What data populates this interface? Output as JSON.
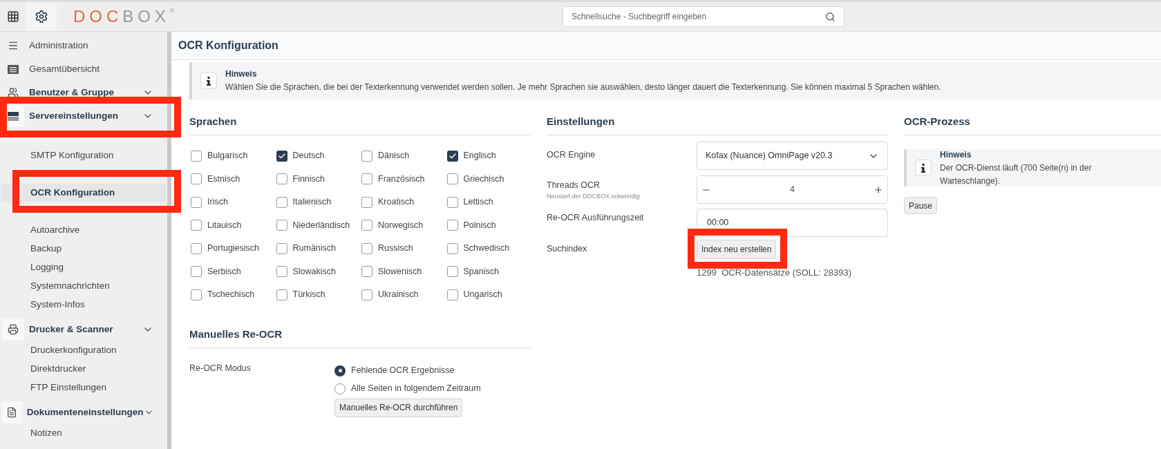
{
  "topbar": {
    "logo_primary": "DOC",
    "logo_secondary": "BOX",
    "logo_mark": "®",
    "search": {
      "placeholder": "Schnellsuche - Suchbegriff eingeben"
    }
  },
  "sidebar": {
    "items": [
      {
        "kind": "link",
        "label": "Administration"
      },
      {
        "kind": "link",
        "label": "Gesamtübersicht"
      },
      {
        "kind": "group",
        "label": "Benutzer & Gruppe"
      },
      {
        "kind": "group",
        "label": "Servereinstellungen"
      },
      {
        "kind": "hidden"
      },
      {
        "kind": "sub",
        "label": "SMTP Konfiguration",
        "selected": false
      },
      {
        "kind": "hidden"
      },
      {
        "kind": "sub",
        "label": "OCR Konfiguration",
        "selected": true
      },
      {
        "kind": "hidden"
      },
      {
        "kind": "sub",
        "label": "Autoarchive",
        "selected": false
      },
      {
        "kind": "sub",
        "label": "Backup",
        "selected": false
      },
      {
        "kind": "sub",
        "label": "Logging",
        "selected": false
      },
      {
        "kind": "sub",
        "label": "Systemnachrichten",
        "selected": false
      },
      {
        "kind": "sub",
        "label": "System-Infos",
        "selected": false
      },
      {
        "kind": "group",
        "label": "Drucker & Scanner"
      },
      {
        "kind": "sub",
        "label": "Druckerkonfiguration",
        "selected": false
      },
      {
        "kind": "sub",
        "label": "Direktdrucker",
        "selected": false
      },
      {
        "kind": "sub",
        "label": "FTP Einstellungen",
        "selected": false
      },
      {
        "kind": "group",
        "label": "Dokumenteneinstellungen"
      },
      {
        "kind": "sub",
        "label": "Notizen",
        "selected": false
      }
    ]
  },
  "page_title": "OCR Konfiguration",
  "notice": {
    "title": "Hinweis",
    "text": "Wählen Sie die Sprachen, die bei der Texterkennung verwendet werden sollen. Je mehr Sprachen sie auswählen, desto länger dauert die Texterkennung. Sie können maximal 5 Sprachen wählen."
  },
  "languages": {
    "heading": "Sprachen",
    "items": [
      {
        "label": "Bulgarisch",
        "checked": false
      },
      {
        "label": "Deutsch",
        "checked": true
      },
      {
        "label": "Dänisch",
        "checked": false
      },
      {
        "label": "Englisch",
        "checked": true
      },
      {
        "label": "Estnisch",
        "checked": false
      },
      {
        "label": "Finnisch",
        "checked": false
      },
      {
        "label": "Französisch",
        "checked": false
      },
      {
        "label": "Griechisch",
        "checked": false
      },
      {
        "label": "Irisch",
        "checked": false
      },
      {
        "label": "Italienisch",
        "checked": false
      },
      {
        "label": "Kroatisch",
        "checked": false
      },
      {
        "label": "Lettisch",
        "checked": false
      },
      {
        "label": "Litauisch",
        "checked": false
      },
      {
        "label": "Niederländisch",
        "checked": false
      },
      {
        "label": "Norwegisch",
        "checked": false
      },
      {
        "label": "Polnisch",
        "checked": false
      },
      {
        "label": "Portugiesisch",
        "checked": false
      },
      {
        "label": "Rumänisch",
        "checked": false
      },
      {
        "label": "Russisch",
        "checked": false
      },
      {
        "label": "Schwedisch",
        "checked": false
      },
      {
        "label": "Serbisch",
        "checked": false
      },
      {
        "label": "Slowakisch",
        "checked": false
      },
      {
        "label": "Slowenisch",
        "checked": false
      },
      {
        "label": "Spanisch",
        "checked": false
      },
      {
        "label": "Tschechisch",
        "checked": false
      },
      {
        "label": "Türkisch",
        "checked": false
      },
      {
        "label": "Ukrainisch",
        "checked": false
      },
      {
        "label": "Ungarisch",
        "checked": false
      }
    ]
  },
  "manual_reocr": {
    "heading": "Manuelles Re-OCR",
    "label": "Re-OCR Modus",
    "options": [
      {
        "label": "Fehlende OCR Ergebnisse",
        "selected": true
      },
      {
        "label": "Alle Seiten in folgendem Zeitraum",
        "selected": false
      }
    ],
    "button": "Manuelles Re-OCR durchführen"
  },
  "settings": {
    "heading": "Einstellungen",
    "ocr_engine": {
      "label": "OCR Engine",
      "value": "Kofax (Nuance) OmniPage v20.3"
    },
    "threads": {
      "label": "Threads OCR",
      "hint": "Neustart der DOCBOX notwendig",
      "value": "4"
    },
    "reocr_time": {
      "label": "Re-OCR Ausführungszeit",
      "value": "00:00"
    },
    "search_index": {
      "label": "Suchindex",
      "button": "Index neu erstellen",
      "status": "1299  OCR-Datensätze (SOLL: 28393)"
    }
  },
  "process": {
    "heading": "OCR-Prozess",
    "notice": {
      "title": "Hinweis",
      "text": "Der OCR-Dienst läuft (700 Seite(n) in der Warteschlange)."
    },
    "button": "Pause"
  }
}
